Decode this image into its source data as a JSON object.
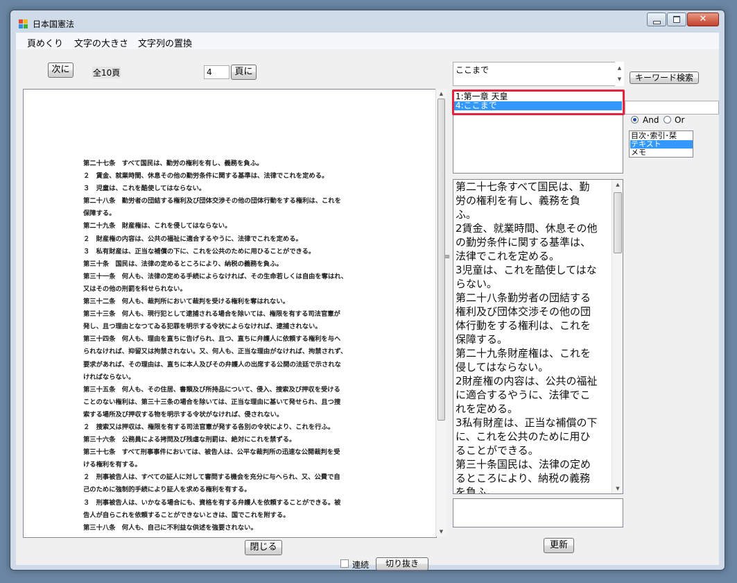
{
  "window": {
    "title": "日本国憲法",
    "close_glyph": "✕"
  },
  "menu": [
    "頁めくり",
    "文字の大きさ",
    "文字列の置換"
  ],
  "toolbar": {
    "next_label": "次に",
    "total_pages": "全10頁",
    "page_input": "4",
    "goto_label": "頁に"
  },
  "search": {
    "query": "ここまで",
    "button": "キーワード検索",
    "and_label": "And",
    "or_label": "Or",
    "mode": "And",
    "keyword2": ""
  },
  "results": {
    "items": [
      {
        "label": "1:第一章  天皇",
        "selected": false
      },
      {
        "label": "4:ここまで",
        "selected": true
      }
    ]
  },
  "scope": {
    "items": [
      {
        "label": "目次･索引･栞",
        "selected": false
      },
      {
        "label": "テキスト",
        "selected": true
      },
      {
        "label": "メモ",
        "selected": false
      }
    ]
  },
  "page_lines": [
    "第二十七条　すべて国民は、勤労の権利を有し、義務を負ふ。",
    "２　賃金、就業時間、休息その他の勤労条件に関する基準は、法律でこれを定める。",
    "３　児童は、これを酷使してはならない。",
    "第二十八条　勤労者の団結する権利及び団体交渉その他の団体行動をする権利は、これを",
    "保障する。",
    "第二十九条　財産権は、これを侵してはならない。",
    "２　財産権の内容は、公共の福祉に適合するやうに、法律でこれを定める。",
    "３　私有財産は、正当な補償の下に、これを公共のために用ひることができる。",
    "第三十条　国民は、法律の定めるところにより、納税の義務を負ふ。",
    "第三十一条　何人も、法律の定める手続によらなければ、その生命若しくは自由を奪はれ、",
    "又はその他の刑罰を科せられない。",
    "第三十二条　何人も、裁判所において裁判を受ける権利を奪はれない。",
    "第三十三条　何人も、現行犯として逮捕される場合を除いては、権限を有する司法官憲が",
    "発し、且つ理由となつてゐる犯罪を明示する令状によらなければ、逮捕されない。",
    "第三十四条　何人も、理由を直ちに告げられ、且つ、直ちに弁護人に依頼する権利を与へ",
    "られなければ、抑留又は拘禁されない。又、何人も、正当な理由がなければ、拘禁されず、",
    "要求があれば、その理由は、直ちに本人及びその弁護人の出席する公開の法廷で示されな",
    "ければならない。",
    "第三十五条　何人も、その住居、書類及び所持品について、侵入、捜索及び押収を受ける",
    "ことのない権利は、第三十三条の場合を除いては、正当な理由に基いて発せられ、且つ捜",
    "索する場所及び押収する物を明示する令状がなければ、侵されない。",
    "２　捜索又は押収は、権限を有する司法官憲が発する各別の令状により、これを行ふ。",
    "第三十六条　公務員による拷問及び残虐な刑罰は、絶対にこれを禁ずる。",
    "第三十七条　すべて刑事事件においては、被告人は、公平な裁判所の迅速な公開裁判を受",
    "ける権利を有する。",
    "２　刑事被告人は、すべての証人に対して審問する機会を充分に与へられ、又、公費で自",
    "己のために強制的手続により証人を求める権利を有する。",
    "３　刑事被告人は、いかなる場合にも、資格を有する弁護人を依頼することができる。被",
    "告人が自らこれを依頼することができないときは、国でこれを附する。",
    "第三十八条　何人も、自己に不利益な供述を強要されない。"
  ],
  "text_lines": [
    "第二十七条すべて国民は、勤",
    "労の権利を有し、義務を負",
    "ふ。",
    "2賃金、就業時間、休息その他",
    "の勤労条件に関する基準は、",
    "法律でこれを定める。",
    "3児童は、これを酷使してはな",
    "らない。",
    "第二十八条勤労者の団結する",
    "権利及び団体交渉その他の団",
    "体行動をする権利は、これを",
    "保障する。",
    "第二十九条財産権は、これを",
    "侵してはならない。",
    "2財産権の内容は、公共の福祉",
    "に適合するやうに、法律でこ",
    "れを定める。",
    "3私有財産は、正当な補償の下",
    "に、これを公共のために用ひ",
    "ることができる。",
    "第三十条国民は、法律の定め",
    "るところにより、納税の義務",
    "を負ふ。"
  ],
  "footer": {
    "close_label": "閉じる",
    "update_label": "更新",
    "continuous_label": "連続",
    "crop_label": "切り抜き"
  },
  "colors": {
    "selection": "#3399ff",
    "highlight_border": "#e8213f"
  },
  "icons": {
    "app": "app-logo-icon",
    "minimize": "minimize-icon",
    "maximize": "maximize-icon",
    "close": "close-icon"
  }
}
